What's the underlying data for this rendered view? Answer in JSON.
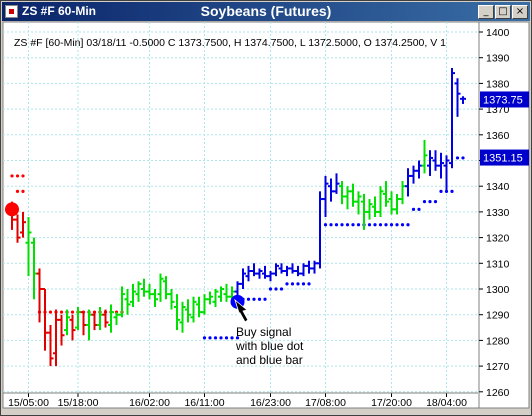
{
  "window": {
    "symbol_title": "ZS #F 60-Min",
    "title": "Soybeans (Futures)",
    "buttons": {
      "minimize": "_",
      "maximize": "□",
      "close": "×"
    }
  },
  "colors": {
    "green_bar": "#00e000",
    "red_bar": "#e00000",
    "blue_bar": "#0000e0",
    "red_dot": "#ff0000",
    "blue_dot": "#0000ff",
    "grid": "#aee6ea",
    "price_label_bg": "#0000cc"
  },
  "chart_data": {
    "type": "ohlc",
    "info_line": "ZS #F [60-Min] 03/18/11  -0.5000 C 1373.7500, H 1374.7500, L 1372.5000, O 1374.2500, V 1",
    "y_ticks": [
      1260,
      1270,
      1280,
      1290,
      1300,
      1310,
      1320,
      1330,
      1340,
      1350,
      1360,
      1370,
      1380,
      1390,
      1400
    ],
    "ylim": [
      1256,
      1402
    ],
    "x_ticks": [
      {
        "label": "15/05:00",
        "index": 3
      },
      {
        "label": "15/18:00",
        "index": 12
      },
      {
        "label": "16/02:00",
        "index": 25
      },
      {
        "label": "16/11:00",
        "index": 35
      },
      {
        "label": "16/23:00",
        "index": 47
      },
      {
        "label": "17/08:00",
        "index": 57
      },
      {
        "label": "17/20:00",
        "index": 69
      },
      {
        "label": "18/04:00",
        "index": 79
      }
    ],
    "price_labels": [
      1373.75,
      1351.15
    ],
    "annotation": [
      "Buy signal",
      "with blue dot",
      "and blue bar"
    ],
    "signals": [
      {
        "type": "sell",
        "index": 0,
        "price": 1331
      },
      {
        "type": "buy",
        "index": 41,
        "price": 1295
      }
    ],
    "bars": [
      {
        "c": "red",
        "o": 1330,
        "h": 1334,
        "l": 1323,
        "cl": 1327
      },
      {
        "c": "red",
        "o": 1327,
        "h": 1329,
        "l": 1318,
        "cl": 1320
      },
      {
        "c": "red",
        "o": 1322,
        "h": 1330,
        "l": 1320,
        "cl": 1326
      },
      {
        "c": "green",
        "o": 1318,
        "h": 1328,
        "l": 1305,
        "cl": 1322
      },
      {
        "c": "green",
        "o": 1318,
        "h": 1320,
        "l": 1296,
        "cl": 1306
      },
      {
        "c": "red",
        "o": 1306,
        "h": 1308,
        "l": 1287,
        "cl": 1300
      },
      {
        "c": "red",
        "o": 1300,
        "h": 1300,
        "l": 1276,
        "cl": 1283
      },
      {
        "c": "red",
        "o": 1283,
        "h": 1286,
        "l": 1270,
        "cl": 1273
      },
      {
        "c": "red",
        "o": 1275,
        "h": 1292,
        "l": 1270,
        "cl": 1288
      },
      {
        "c": "red",
        "o": 1288,
        "h": 1290,
        "l": 1278,
        "cl": 1282
      },
      {
        "c": "green",
        "o": 1284,
        "h": 1292,
        "l": 1282,
        "cl": 1289
      },
      {
        "c": "red",
        "o": 1288,
        "h": 1290,
        "l": 1280,
        "cl": 1284
      },
      {
        "c": "green",
        "o": 1285,
        "h": 1293,
        "l": 1284,
        "cl": 1291
      },
      {
        "c": "red",
        "o": 1291,
        "h": 1291,
        "l": 1282,
        "cl": 1286
      },
      {
        "c": "green",
        "o": 1286,
        "h": 1292,
        "l": 1280,
        "cl": 1290
      },
      {
        "c": "red",
        "o": 1290,
        "h": 1291,
        "l": 1284,
        "cl": 1286
      },
      {
        "c": "green",
        "o": 1286,
        "h": 1293,
        "l": 1284,
        "cl": 1290
      },
      {
        "c": "red",
        "o": 1290,
        "h": 1292,
        "l": 1285,
        "cl": 1287
      },
      {
        "c": "green",
        "o": 1286,
        "h": 1294,
        "l": 1283,
        "cl": 1291
      },
      {
        "c": "green",
        "o": 1289,
        "h": 1291,
        "l": 1286,
        "cl": 1290
      },
      {
        "c": "green",
        "o": 1290,
        "h": 1301,
        "l": 1289,
        "cl": 1298
      },
      {
        "c": "green",
        "o": 1296,
        "h": 1300,
        "l": 1290,
        "cl": 1294
      },
      {
        "c": "green",
        "o": 1295,
        "h": 1302,
        "l": 1293,
        "cl": 1299
      },
      {
        "c": "green",
        "o": 1298,
        "h": 1303,
        "l": 1295,
        "cl": 1302
      },
      {
        "c": "green",
        "o": 1300,
        "h": 1304,
        "l": 1297,
        "cl": 1299
      },
      {
        "c": "green",
        "o": 1299,
        "h": 1302,
        "l": 1296,
        "cl": 1298
      },
      {
        "c": "green",
        "o": 1298,
        "h": 1300,
        "l": 1293,
        "cl": 1296
      },
      {
        "c": "green",
        "o": 1298,
        "h": 1306,
        "l": 1295,
        "cl": 1304
      },
      {
        "c": "green",
        "o": 1303,
        "h": 1305,
        "l": 1296,
        "cl": 1298
      },
      {
        "c": "green",
        "o": 1298,
        "h": 1300,
        "l": 1292,
        "cl": 1295
      },
      {
        "c": "green",
        "o": 1293,
        "h": 1298,
        "l": 1284,
        "cl": 1288
      },
      {
        "c": "green",
        "o": 1287,
        "h": 1295,
        "l": 1283,
        "cl": 1293
      },
      {
        "c": "green",
        "o": 1292,
        "h": 1296,
        "l": 1287,
        "cl": 1290
      },
      {
        "c": "green",
        "o": 1289,
        "h": 1297,
        "l": 1287,
        "cl": 1295
      },
      {
        "c": "green",
        "o": 1294,
        "h": 1297,
        "l": 1289,
        "cl": 1291
      },
      {
        "c": "green",
        "o": 1291,
        "h": 1298,
        "l": 1290,
        "cl": 1296
      },
      {
        "c": "green",
        "o": 1296,
        "h": 1299,
        "l": 1294,
        "cl": 1297
      },
      {
        "c": "green",
        "o": 1295,
        "h": 1300,
        "l": 1293,
        "cl": 1299
      },
      {
        "c": "green",
        "o": 1297,
        "h": 1301,
        "l": 1295,
        "cl": 1300
      },
      {
        "c": "green",
        "o": 1298,
        "h": 1302,
        "l": 1295,
        "cl": 1297
      },
      {
        "c": "green",
        "o": 1297,
        "h": 1301,
        "l": 1294,
        "cl": 1299
      },
      {
        "c": "blue",
        "o": 1299,
        "h": 1303,
        "l": 1295,
        "cl": 1302
      },
      {
        "c": "blue",
        "o": 1302,
        "h": 1308,
        "l": 1300,
        "cl": 1306
      },
      {
        "c": "blue",
        "o": 1305,
        "h": 1309,
        "l": 1303,
        "cl": 1307
      },
      {
        "c": "blue",
        "o": 1307,
        "h": 1310,
        "l": 1305,
        "cl": 1306
      },
      {
        "c": "blue",
        "o": 1306,
        "h": 1308,
        "l": 1304,
        "cl": 1307
      },
      {
        "c": "blue",
        "o": 1306,
        "h": 1309,
        "l": 1304,
        "cl": 1305
      },
      {
        "c": "blue",
        "o": 1305,
        "h": 1307,
        "l": 1303,
        "cl": 1306
      },
      {
        "c": "blue",
        "o": 1306,
        "h": 1310,
        "l": 1305,
        "cl": 1309
      },
      {
        "c": "blue",
        "o": 1308,
        "h": 1310,
        "l": 1306,
        "cl": 1307
      },
      {
        "c": "blue",
        "o": 1307,
        "h": 1309,
        "l": 1305,
        "cl": 1308
      },
      {
        "c": "blue",
        "o": 1308,
        "h": 1310,
        "l": 1306,
        "cl": 1307
      },
      {
        "c": "blue",
        "o": 1307,
        "h": 1309,
        "l": 1305,
        "cl": 1306
      },
      {
        "c": "blue",
        "o": 1306,
        "h": 1310,
        "l": 1305,
        "cl": 1309
      },
      {
        "c": "blue",
        "o": 1309,
        "h": 1311,
        "l": 1306,
        "cl": 1308
      },
      {
        "c": "blue",
        "o": 1308,
        "h": 1311,
        "l": 1306,
        "cl": 1310
      },
      {
        "c": "blue",
        "o": 1310,
        "h": 1338,
        "l": 1308,
        "cl": 1335
      },
      {
        "c": "blue",
        "o": 1335,
        "h": 1344,
        "l": 1328,
        "cl": 1341
      },
      {
        "c": "blue",
        "o": 1340,
        "h": 1343,
        "l": 1334,
        "cl": 1338
      },
      {
        "c": "blue",
        "o": 1338,
        "h": 1345,
        "l": 1337,
        "cl": 1341
      },
      {
        "c": "green",
        "o": 1340,
        "h": 1342,
        "l": 1333,
        "cl": 1336
      },
      {
        "c": "green",
        "o": 1336,
        "h": 1340,
        "l": 1331,
        "cl": 1338
      },
      {
        "c": "green",
        "o": 1338,
        "h": 1341,
        "l": 1332,
        "cl": 1334
      },
      {
        "c": "green",
        "o": 1334,
        "h": 1338,
        "l": 1329,
        "cl": 1336
      },
      {
        "c": "green",
        "o": 1334,
        "h": 1337,
        "l": 1323,
        "cl": 1330
      },
      {
        "c": "green",
        "o": 1330,
        "h": 1335,
        "l": 1327,
        "cl": 1333
      },
      {
        "c": "green",
        "o": 1332,
        "h": 1336,
        "l": 1328,
        "cl": 1330
      },
      {
        "c": "green",
        "o": 1330,
        "h": 1340,
        "l": 1328,
        "cl": 1338
      },
      {
        "c": "green",
        "o": 1337,
        "h": 1342,
        "l": 1332,
        "cl": 1334
      },
      {
        "c": "green",
        "o": 1335,
        "h": 1338,
        "l": 1329,
        "cl": 1331
      },
      {
        "c": "green",
        "o": 1331,
        "h": 1337,
        "l": 1329,
        "cl": 1335
      },
      {
        "c": "green",
        "o": 1335,
        "h": 1342,
        "l": 1333,
        "cl": 1340
      },
      {
        "c": "blue",
        "o": 1340,
        "h": 1347,
        "l": 1336,
        "cl": 1344
      },
      {
        "c": "blue",
        "o": 1344,
        "h": 1348,
        "l": 1341,
        "cl": 1346
      },
      {
        "c": "blue",
        "o": 1346,
        "h": 1350,
        "l": 1343,
        "cl": 1348
      },
      {
        "c": "green",
        "o": 1348,
        "h": 1358,
        "l": 1345,
        "cl": 1352
      },
      {
        "c": "blue",
        "o": 1348,
        "h": 1354,
        "l": 1344,
        "cl": 1351
      },
      {
        "c": "blue",
        "o": 1350,
        "h": 1354,
        "l": 1346,
        "cl": 1348
      },
      {
        "c": "blue",
        "o": 1348,
        "h": 1353,
        "l": 1343,
        "cl": 1349
      },
      {
        "c": "blue",
        "o": 1348,
        "h": 1352,
        "l": 1338,
        "cl": 1350
      },
      {
        "c": "blue",
        "o": 1349,
        "h": 1386,
        "l": 1347,
        "cl": 1384
      },
      {
        "c": "blue",
        "o": 1380,
        "h": 1382,
        "l": 1367,
        "cl": 1376
      },
      {
        "c": "blue",
        "o": 1374,
        "h": 1375,
        "l": 1372,
        "cl": 1374
      }
    ],
    "dots": [
      {
        "c": "red",
        "i": 0,
        "y": 1344
      },
      {
        "c": "red",
        "i": 1,
        "y": 1344
      },
      {
        "c": "red",
        "i": 2,
        "y": 1344
      },
      {
        "c": "red",
        "i": 1,
        "y": 1338
      },
      {
        "c": "red",
        "i": 2,
        "y": 1338
      },
      {
        "c": "red",
        "i": 5,
        "y": 1291
      },
      {
        "c": "red",
        "i": 6,
        "y": 1291
      },
      {
        "c": "red",
        "i": 7,
        "y": 1291
      },
      {
        "c": "red",
        "i": 8,
        "y": 1291
      },
      {
        "c": "red",
        "i": 9,
        "y": 1291
      },
      {
        "c": "red",
        "i": 10,
        "y": 1291
      },
      {
        "c": "red",
        "i": 11,
        "y": 1291
      },
      {
        "c": "red",
        "i": 12,
        "y": 1291
      },
      {
        "c": "red",
        "i": 13,
        "y": 1291
      },
      {
        "c": "red",
        "i": 14,
        "y": 1291
      },
      {
        "c": "red",
        "i": 15,
        "y": 1291
      },
      {
        "c": "red",
        "i": 16,
        "y": 1291
      },
      {
        "c": "red",
        "i": 17,
        "y": 1291
      },
      {
        "c": "red",
        "i": 18,
        "y": 1291
      },
      {
        "c": "red",
        "i": 19,
        "y": 1291
      },
      {
        "c": "red",
        "i": 20,
        "y": 1291
      },
      {
        "c": "blue",
        "i": 35,
        "y": 1281
      },
      {
        "c": "blue",
        "i": 36,
        "y": 1281
      },
      {
        "c": "blue",
        "i": 37,
        "y": 1281
      },
      {
        "c": "blue",
        "i": 38,
        "y": 1281
      },
      {
        "c": "blue",
        "i": 39,
        "y": 1281
      },
      {
        "c": "blue",
        "i": 40,
        "y": 1281
      },
      {
        "c": "blue",
        "i": 41,
        "y": 1281
      },
      {
        "c": "blue",
        "i": 42,
        "y": 1296
      },
      {
        "c": "blue",
        "i": 43,
        "y": 1296
      },
      {
        "c": "blue",
        "i": 44,
        "y": 1296
      },
      {
        "c": "blue",
        "i": 45,
        "y": 1296
      },
      {
        "c": "blue",
        "i": 46,
        "y": 1296
      },
      {
        "c": "blue",
        "i": 47,
        "y": 1300
      },
      {
        "c": "blue",
        "i": 48,
        "y": 1300
      },
      {
        "c": "blue",
        "i": 49,
        "y": 1300
      },
      {
        "c": "blue",
        "i": 50,
        "y": 1302
      },
      {
        "c": "blue",
        "i": 51,
        "y": 1302
      },
      {
        "c": "blue",
        "i": 52,
        "y": 1302
      },
      {
        "c": "blue",
        "i": 53,
        "y": 1302
      },
      {
        "c": "blue",
        "i": 54,
        "y": 1302
      },
      {
        "c": "blue",
        "i": 57,
        "y": 1325
      },
      {
        "c": "blue",
        "i": 58,
        "y": 1325
      },
      {
        "c": "blue",
        "i": 59,
        "y": 1325
      },
      {
        "c": "blue",
        "i": 60,
        "y": 1325
      },
      {
        "c": "blue",
        "i": 61,
        "y": 1325
      },
      {
        "c": "blue",
        "i": 62,
        "y": 1325
      },
      {
        "c": "blue",
        "i": 63,
        "y": 1325
      },
      {
        "c": "blue",
        "i": 64,
        "y": 1325
      },
      {
        "c": "blue",
        "i": 65,
        "y": 1325
      },
      {
        "c": "blue",
        "i": 66,
        "y": 1325
      },
      {
        "c": "blue",
        "i": 67,
        "y": 1325
      },
      {
        "c": "blue",
        "i": 68,
        "y": 1325
      },
      {
        "c": "blue",
        "i": 69,
        "y": 1325
      },
      {
        "c": "blue",
        "i": 70,
        "y": 1325
      },
      {
        "c": "blue",
        "i": 71,
        "y": 1325
      },
      {
        "c": "blue",
        "i": 72,
        "y": 1325
      },
      {
        "c": "blue",
        "i": 73,
        "y": 1331
      },
      {
        "c": "blue",
        "i": 74,
        "y": 1331
      },
      {
        "c": "blue",
        "i": 75,
        "y": 1334
      },
      {
        "c": "blue",
        "i": 76,
        "y": 1334
      },
      {
        "c": "blue",
        "i": 77,
        "y": 1334
      },
      {
        "c": "blue",
        "i": 78,
        "y": 1338
      },
      {
        "c": "blue",
        "i": 79,
        "y": 1338
      },
      {
        "c": "blue",
        "i": 80,
        "y": 1338
      },
      {
        "c": "blue",
        "i": 81,
        "y": 1351
      },
      {
        "c": "blue",
        "i": 82,
        "y": 1351
      }
    ]
  }
}
